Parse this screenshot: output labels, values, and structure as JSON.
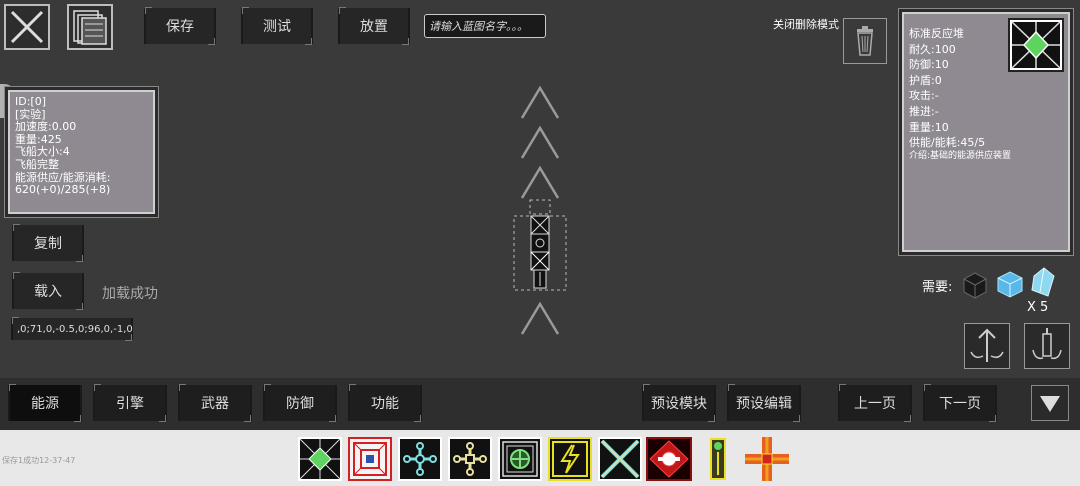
{
  "toolbar": {
    "save_label": "保存",
    "test_label": "测试",
    "place_label": "放置",
    "name_placeholder": "请输入蓝图名字。。。",
    "close_delete_label": "关闭删除模式"
  },
  "ship_info": {
    "lines": [
      "ID:[0]",
      "[实验]",
      "加速度:0.00",
      "重量:425",
      "飞船大小:4",
      "飞船完整",
      "能源供应/能源消耗:",
      "620(+0)/285(+8)"
    ]
  },
  "side_buttons": {
    "copy_label": "复制",
    "load_label": "载入",
    "load_status": "加载成功",
    "code_text": ",0;71,0,-0.5,0;96,0,-1,0"
  },
  "module_info": {
    "name": "标准反应堆",
    "durability": "耐久:100",
    "defense": "防御:10",
    "shield": "护盾:0",
    "attack": "攻击:-",
    "thrust": "推进:-",
    "weight": "重量:10",
    "power": "供能/能耗:45/5",
    "description": "介绍:基础的能源供应装置"
  },
  "requirements": {
    "label": "需要:",
    "count": "X 5"
  },
  "categories": {
    "energy": "能源",
    "engine": "引擎",
    "weapon": "武器",
    "defense": "防御",
    "function": "功能",
    "preset_module": "预设模块",
    "preset_edit": "预设编辑",
    "prev_page": "上一页",
    "next_page": "下一页"
  },
  "status": {
    "save_text": "保存1成功12-37-47"
  },
  "colors": {
    "accent_green": "#5fd35f",
    "accent_red": "#d42020",
    "accent_yellow": "#e8e020",
    "accent_cyan": "#7fe0e0"
  }
}
